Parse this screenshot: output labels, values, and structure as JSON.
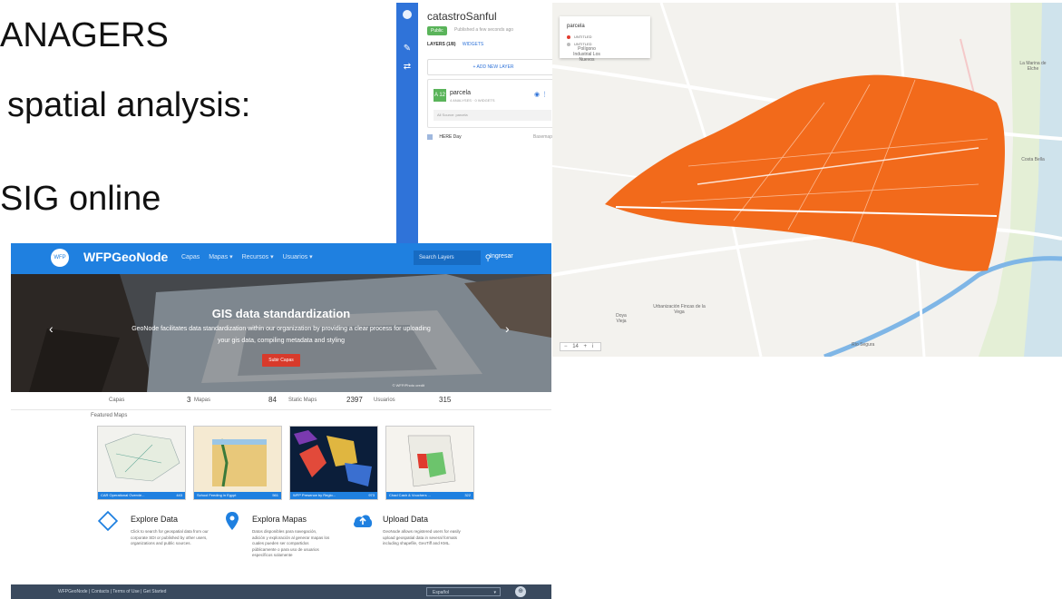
{
  "slide": {
    "line1": "ANAGERS",
    "line2": "spatial analysis:",
    "line3": "SIG online"
  },
  "carto": {
    "map_name": "catastroSanful",
    "status_badge": "Public",
    "published_text": "Published a few seconds ago",
    "tabs": [
      "LAYERS (1/8)",
      "WIDGETS"
    ],
    "add_layer": "+ ADD NEW LAYER",
    "layer": {
      "swatch": "A 12",
      "name": "parcela",
      "subtitle": "4 ANALYSES · 0 WIDGETS",
      "source": "All Source: parcela"
    },
    "basemap": {
      "name": "HERE Day",
      "value": "Basemap"
    },
    "legend": {
      "title": "parcela",
      "items": [
        {
          "label": "UNTITLED",
          "color": "#e23b2e"
        },
        {
          "label": "UNTITLED",
          "color": "#bbbbbb"
        }
      ]
    },
    "zoom": {
      "minus": "−",
      "level": "14",
      "plus": "+",
      "info": "i"
    },
    "places": [
      {
        "id": "poligono",
        "text": "Polígono Industrial Los Nuevos"
      },
      {
        "id": "marina",
        "text": "La Marina de Elche"
      },
      {
        "id": "costa",
        "text": "Costa Bella"
      },
      {
        "id": "doya",
        "text": "Doya Vieja"
      },
      {
        "id": "urbanizacion",
        "text": "Urbanización Fincas de la Vega"
      },
      {
        "id": "rio",
        "text": "Río Segura"
      }
    ],
    "parcel_color": "#f26a1b"
  },
  "geonode": {
    "brand": "WFPGeoNode",
    "logo_text": "WFP",
    "menu": [
      "Capas",
      "Mapas ▾",
      "Recursos ▾",
      "Usuarios ▾"
    ],
    "search_placeholder": "Search Layers",
    "login": "Ingresar",
    "hero": {
      "title": "GIS data standardization",
      "subtitle": "GeoNode facilitates data standardization within our organization by providing a clear process for uploading your gis data, compiling metadata and styling",
      "button": "Subir Capas",
      "credit": "© WFP/Photo credit"
    },
    "stats": [
      {
        "label": "Capas",
        "value": "3"
      },
      {
        "label": "Mapas",
        "value": "84"
      },
      {
        "label": "Static Maps",
        "value": "2397"
      },
      {
        "label": "Usuarios",
        "value": "315"
      }
    ],
    "featured_title": "Featured Maps",
    "featured_maps": [
      {
        "title": "CAR Operational Overvie...",
        "count": "443"
      },
      {
        "title": "School Feeding in Egypt",
        "count": "561"
      },
      {
        "title": "WFP Presence by Regio...",
        "count": "973"
      },
      {
        "title": "Chad Cash & Vouchers ...",
        "count": "322"
      }
    ],
    "features": [
      {
        "icon": "diamond-icon",
        "title": "Explore Data",
        "text": "Click to search for geospatial data from our corporate SDI or published by other users, organizations and public sources."
      },
      {
        "icon": "map-pin-icon",
        "title": "Explora Mapas",
        "text": "Datos disponibles para navegación, adición y exploración al generar mapas los cuales pueden ser compartidos públicamente o para uso de usuarios específicos solamente"
      },
      {
        "icon": "cloud-upload-icon",
        "title": "Upload Data",
        "text": "GeoNode allows registered users for easily upload geospatial data in several formats including shapefile, GeoTiff and KML."
      }
    ],
    "footer": {
      "links": "WFPGeoNode | Contacts | Terms of Use | Get Started",
      "language": "Español",
      "caret": "▾"
    },
    "colors": {
      "nav": "#1f80e0",
      "footer": "#3a4a5e",
      "hero_button": "#d83a2b"
    }
  }
}
